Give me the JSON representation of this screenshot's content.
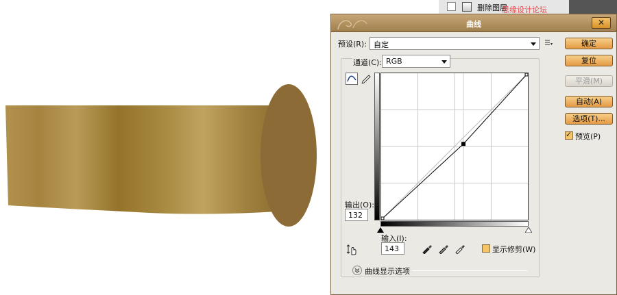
{
  "background": {
    "layer_label": "删除图层",
    "watermark": "思缘设计论坛 www.MISSYUAN.COM"
  },
  "dialog": {
    "title": "曲线",
    "close_glyph": "✕",
    "preset": {
      "label": "预设(R):",
      "value": "自定"
    },
    "channel": {
      "label": "通道(C):",
      "value": "RGB"
    },
    "output": {
      "label": "输出(O):",
      "value": "132"
    },
    "input": {
      "label": "输入(I):",
      "value": "143"
    },
    "show_clipping": {
      "label": "显示修剪(W)",
      "checked": false
    },
    "curve_display_options": "曲线显示选项",
    "buttons": {
      "ok": "确定",
      "reset": "复位",
      "smooth": "平滑(M)",
      "auto": "自动(A)",
      "options": "选项(T)..."
    },
    "preview": {
      "label": "预览(P)",
      "checked": true
    },
    "accent": "#e49a45",
    "title_bar_color": "#b08f5e"
  },
  "chart_data": {
    "type": "line",
    "x": [
      0,
      143,
      255
    ],
    "y": [
      0,
      132,
      255
    ],
    "xlim": [
      0,
      255
    ],
    "ylim": [
      0,
      255
    ],
    "grid": true
  }
}
